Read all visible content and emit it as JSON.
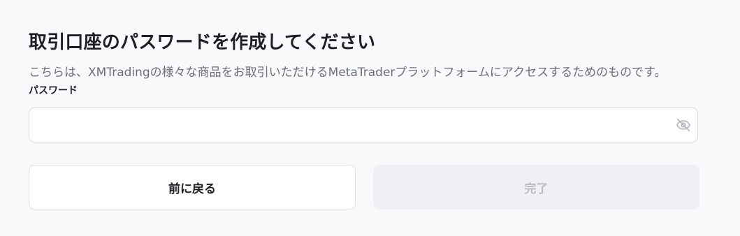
{
  "page": {
    "title": "取引口座のパスワードを作成してください",
    "description": "こちらは、XMTradingの様々な商品をお取引いただけるMetaTraderプラットフォームにアクセスするためのものです。"
  },
  "password_field": {
    "label": "パスワード",
    "value": "",
    "placeholder": "",
    "toggle_icon": "eye-off-icon"
  },
  "buttons": {
    "back_label": "前に戻る",
    "done_label": "完了"
  },
  "colors": {
    "background": "#f8f9fb",
    "text_primary": "#1e1f23",
    "text_secondary": "#6b6f78",
    "disabled_button_bg": "#eef0f3",
    "disabled_button_text": "#b9bcc2"
  }
}
